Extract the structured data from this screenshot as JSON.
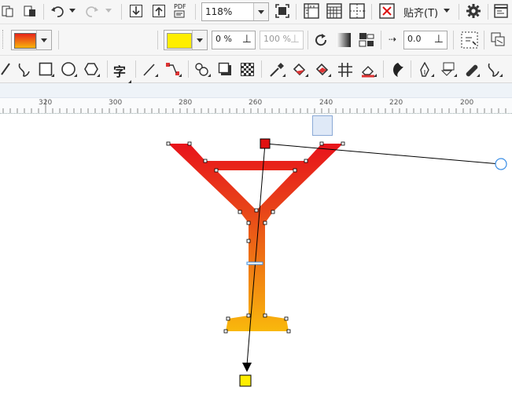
{
  "toolbar_top": {
    "zoom_value": "118%",
    "pdf_label": "PDF",
    "snap_label": "贴齐(T)",
    "icons": [
      "new-document-icon",
      "open-document-icon",
      "undo-icon",
      "redo-icon",
      "import-icon",
      "export-icon",
      "publish-pdf-icon",
      "full-screen-icon",
      "rulers-icon",
      "grid-icon",
      "guidelines-icon",
      "snap-off-icon",
      "settings-icon",
      "application-launcher-icon"
    ]
  },
  "property_bar": {
    "fill_gradient_colors": [
      "#e8251b",
      "#f7b40a"
    ],
    "node_color": "#ffee00",
    "transparency_value": "0 %",
    "node_transparency_value": "100 %",
    "offset_value": "0.0",
    "icons": [
      "fill-picker-icon",
      "linear-transparency-icon",
      "elliptical-transparency-icon",
      "conical-transparency-icon",
      "square-transparency-icon",
      "node-color-picker-icon",
      "rotate-icon",
      "gradient-swatch-icon",
      "free-scale-icon",
      "acceleration-icon",
      "copy-properties-icon",
      "edit-transparency-icon"
    ]
  },
  "toolbox": {
    "text_tool_label": "字",
    "icons": [
      "freehand-tool-icon",
      "bezier-tool-icon",
      "rectangle-tool-icon",
      "ellipse-tool-icon",
      "polygon-tool-icon",
      "text-tool-icon",
      "parallel-dimension-icon",
      "connector-tool-icon",
      "blend-tool-icon",
      "drop-shadow-icon",
      "transparency-tool-icon",
      "eyedropper-icon",
      "interactive-fill-icon",
      "smart-fill-icon",
      "mesh-fill-icon",
      "eraser-icon",
      "contour-icon",
      "pen-tool-icon",
      "color-styles-icon",
      "roughen-icon",
      "smudge-icon"
    ]
  },
  "ruler": {
    "labels": [
      "320",
      "300",
      "280",
      "260",
      "240",
      "220",
      "200"
    ]
  },
  "canvas": {
    "shape_gradient": {
      "start_color": "#e8131b",
      "end_color": "#f9b90c"
    },
    "start_handle_color": "#e01010",
    "end_handle_color": "#ffee00",
    "shape_name": "martini-glass"
  }
}
